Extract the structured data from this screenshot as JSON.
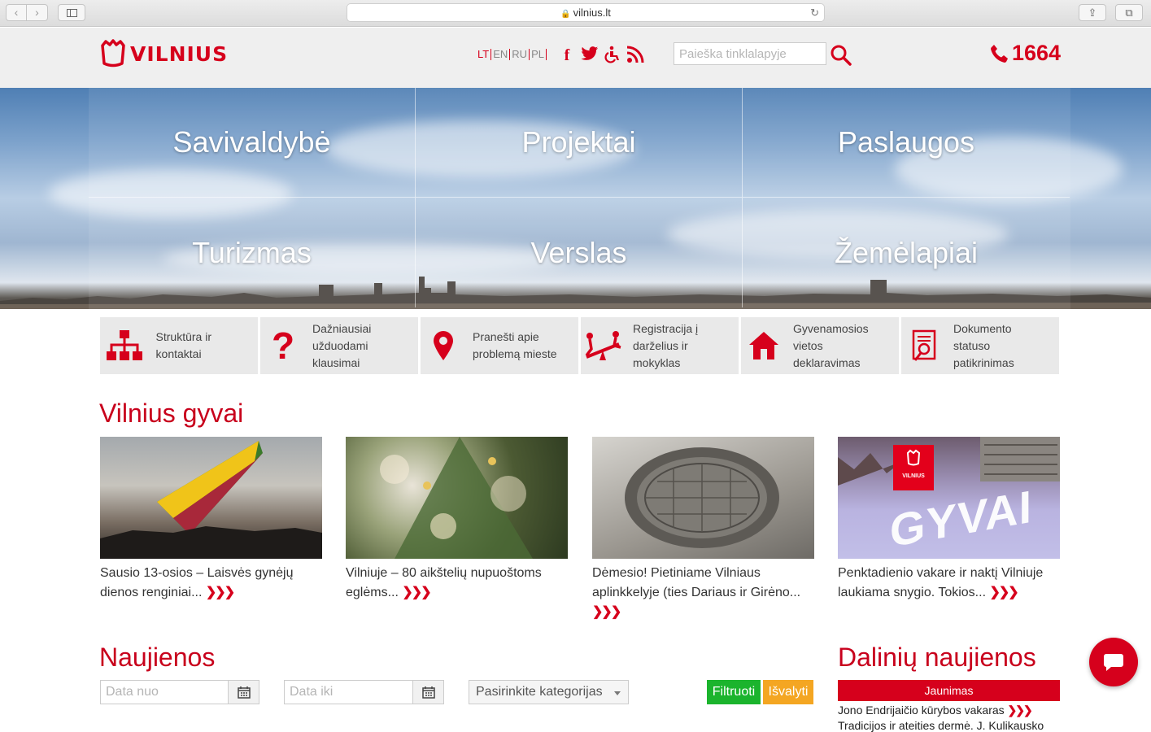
{
  "browser": {
    "url": "vilnius.lt",
    "back_icon": "‹",
    "forward_icon": "›",
    "reload_icon": "↻",
    "share_icon": "⇪",
    "tabs_icon": "⧉"
  },
  "header": {
    "logo_text": "VILNIUS",
    "languages": [
      "LT",
      "EN",
      "RU",
      "PL"
    ],
    "active_language": "LT",
    "search_placeholder": "Paieška tinklalapyje",
    "phone": "1664",
    "brand_color": "#d6001c"
  },
  "hero": {
    "tiles": [
      "Savivaldybė",
      "Projektai",
      "Paslaugos",
      "Turizmas",
      "Verslas",
      "Žemėlapiai"
    ]
  },
  "quick_links": [
    {
      "label": "Struktūra ir kontaktai",
      "icon": "org-structure-icon"
    },
    {
      "label": "Dažniausiai užduodami klausimai",
      "icon": "question-icon"
    },
    {
      "label": "Pranešti apie problemą mieste",
      "icon": "map-pin-icon"
    },
    {
      "label": "Registracija į darželius ir mokyklas",
      "icon": "playground-icon"
    },
    {
      "label": "Gyvenamosios vietos deklaravimas",
      "icon": "home-icon"
    },
    {
      "label": "Dokumento statuso patikrinimas",
      "icon": "document-search-icon"
    }
  ],
  "live": {
    "title": "Vilnius gyvai",
    "more_glyph": "❯❯❯",
    "cards": [
      {
        "text": "Sausio 13-osios – Laisvės gynėjų dienos renginiai..."
      },
      {
        "text": "Vilniuje – 80 aikštelių nupuoštoms eglėms..."
      },
      {
        "text": "Dėmesio! Pietiniame Vilniaus aplinkkelyje (ties Dariaus ir Girėno..."
      },
      {
        "text": "Penktadienio vakare ir naktį Vilniuje laukiama snygio. Tokios..."
      }
    ],
    "banner_badge": "VILNIUS",
    "banner_word": "GYVAI"
  },
  "news": {
    "title": "Naujienos",
    "date_from_placeholder": "Data nuo",
    "date_to_placeholder": "Data iki",
    "category_select": "Pasirinkite kategorijas",
    "filter_label": "Filtruoti",
    "clear_label": "Išvalyti"
  },
  "district": {
    "title": "Dalinių naujienos",
    "category": "Jaunimas",
    "items": [
      "Jono Endrijaičio kūrybos vakaras",
      "Tradicijos ir ateities dermė. J. Kulikausko"
    ]
  }
}
